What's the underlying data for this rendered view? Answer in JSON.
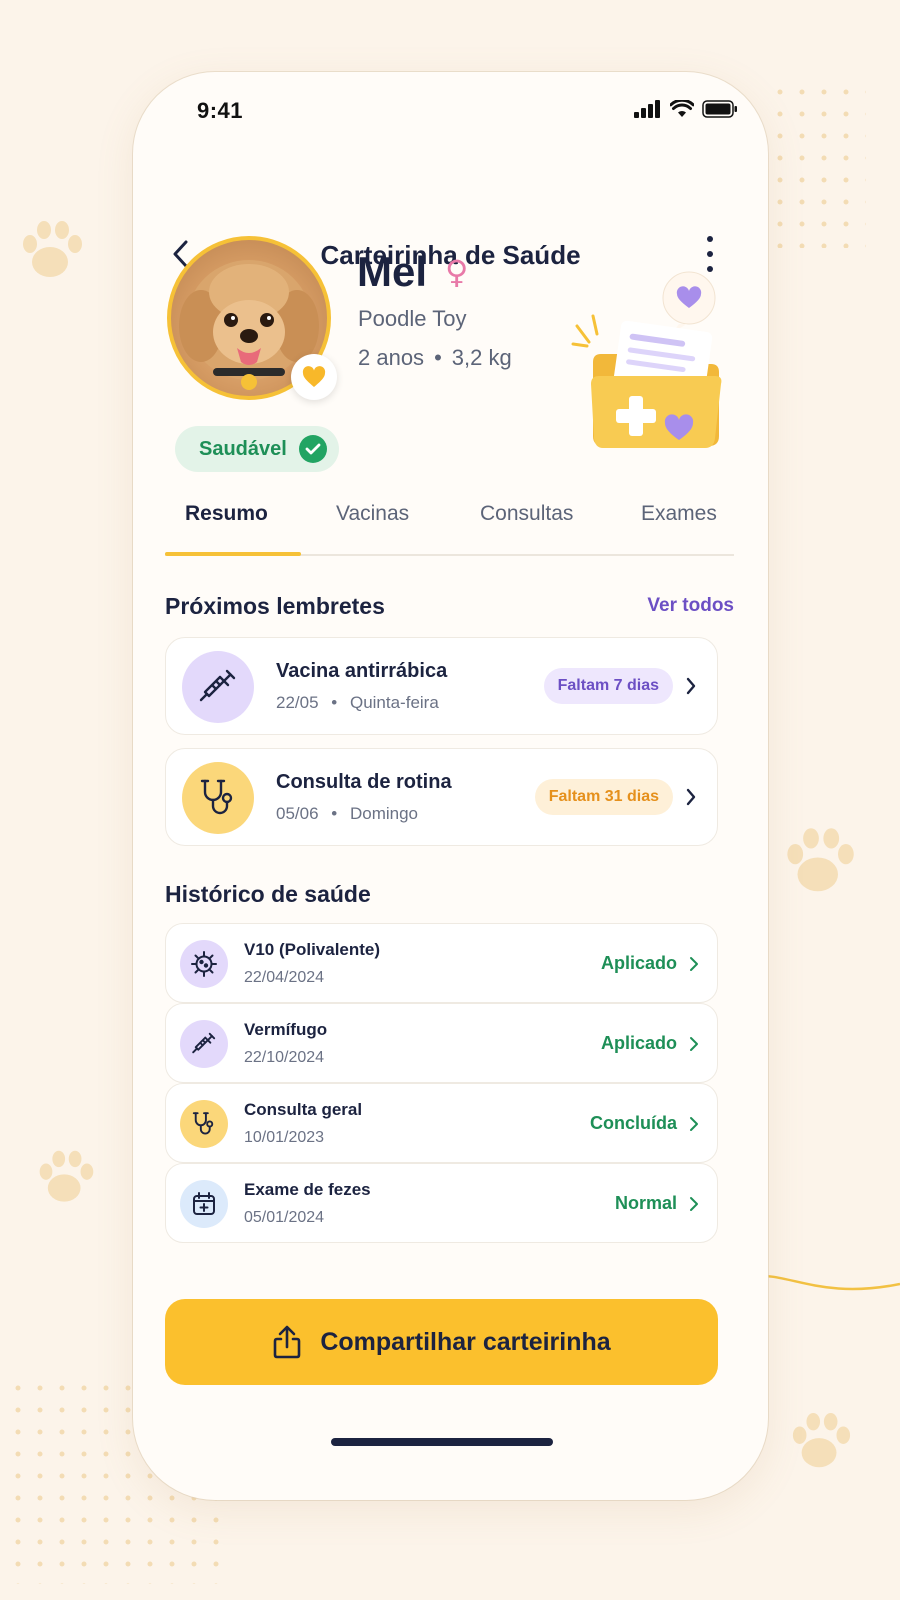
{
  "status_bar": {
    "time": "9:41"
  },
  "header": {
    "title": "Carteirinha de Saúde"
  },
  "pet": {
    "name": "Mel",
    "gender_symbol": "♀",
    "breed": "Poodle Toy",
    "age": "2 anos",
    "separator": "•",
    "weight": "3,2 kg",
    "health_status": "Saudável"
  },
  "tabs": [
    {
      "label": "Resumo",
      "active": true
    },
    {
      "label": "Vacinas",
      "active": false
    },
    {
      "label": "Consultas",
      "active": false
    },
    {
      "label": "Exames",
      "active": false
    }
  ],
  "reminders": {
    "title": "Próximos lembretes",
    "see_all": "Ver todos",
    "items": [
      {
        "title": "Vacina antirrábica",
        "date": "22/05",
        "sep": "•",
        "weekday": "Quinta-feira",
        "badge": "Faltam 7 dias",
        "icon": "syringe-icon",
        "icon_bg": "#E3D9FB",
        "badge_bg": "#EEE7FD",
        "badge_color": "#6C4FC4"
      },
      {
        "title": "Consulta de rotina",
        "date": "05/06",
        "sep": "•",
        "weekday": "Domingo",
        "badge": "Faltam 31 dias",
        "icon": "stethoscope-icon",
        "icon_bg": "#FBD77A",
        "badge_bg": "#FEF0D8",
        "badge_color": "#E5901C"
      }
    ]
  },
  "history": {
    "title": "Histórico de saúde",
    "items": [
      {
        "title": "V10 (Polivalente)",
        "date": "22/04/2024",
        "status": "Aplicado",
        "icon": "virus-icon",
        "icon_bg": "#E3D9FB"
      },
      {
        "title": "Vermífugo",
        "date": "22/10/2024",
        "status": "Aplicado",
        "icon": "syringe-icon",
        "icon_bg": "#E3D9FB"
      },
      {
        "title": "Consulta geral",
        "date": "10/01/2023",
        "status": "Concluída",
        "icon": "stethoscope-icon",
        "icon_bg": "#FBD77A"
      },
      {
        "title": "Exame de fezes",
        "date": "05/01/2024",
        "status": "Normal",
        "icon": "calendar-plus-icon",
        "icon_bg": "#DCEAFB"
      }
    ]
  },
  "share_button": {
    "label": "Compartilhar carteirinha"
  },
  "colors": {
    "accent": "#FBC02D",
    "purple": "#6C4FC4",
    "green": "#1E8F57",
    "navy": "#1C2340"
  }
}
